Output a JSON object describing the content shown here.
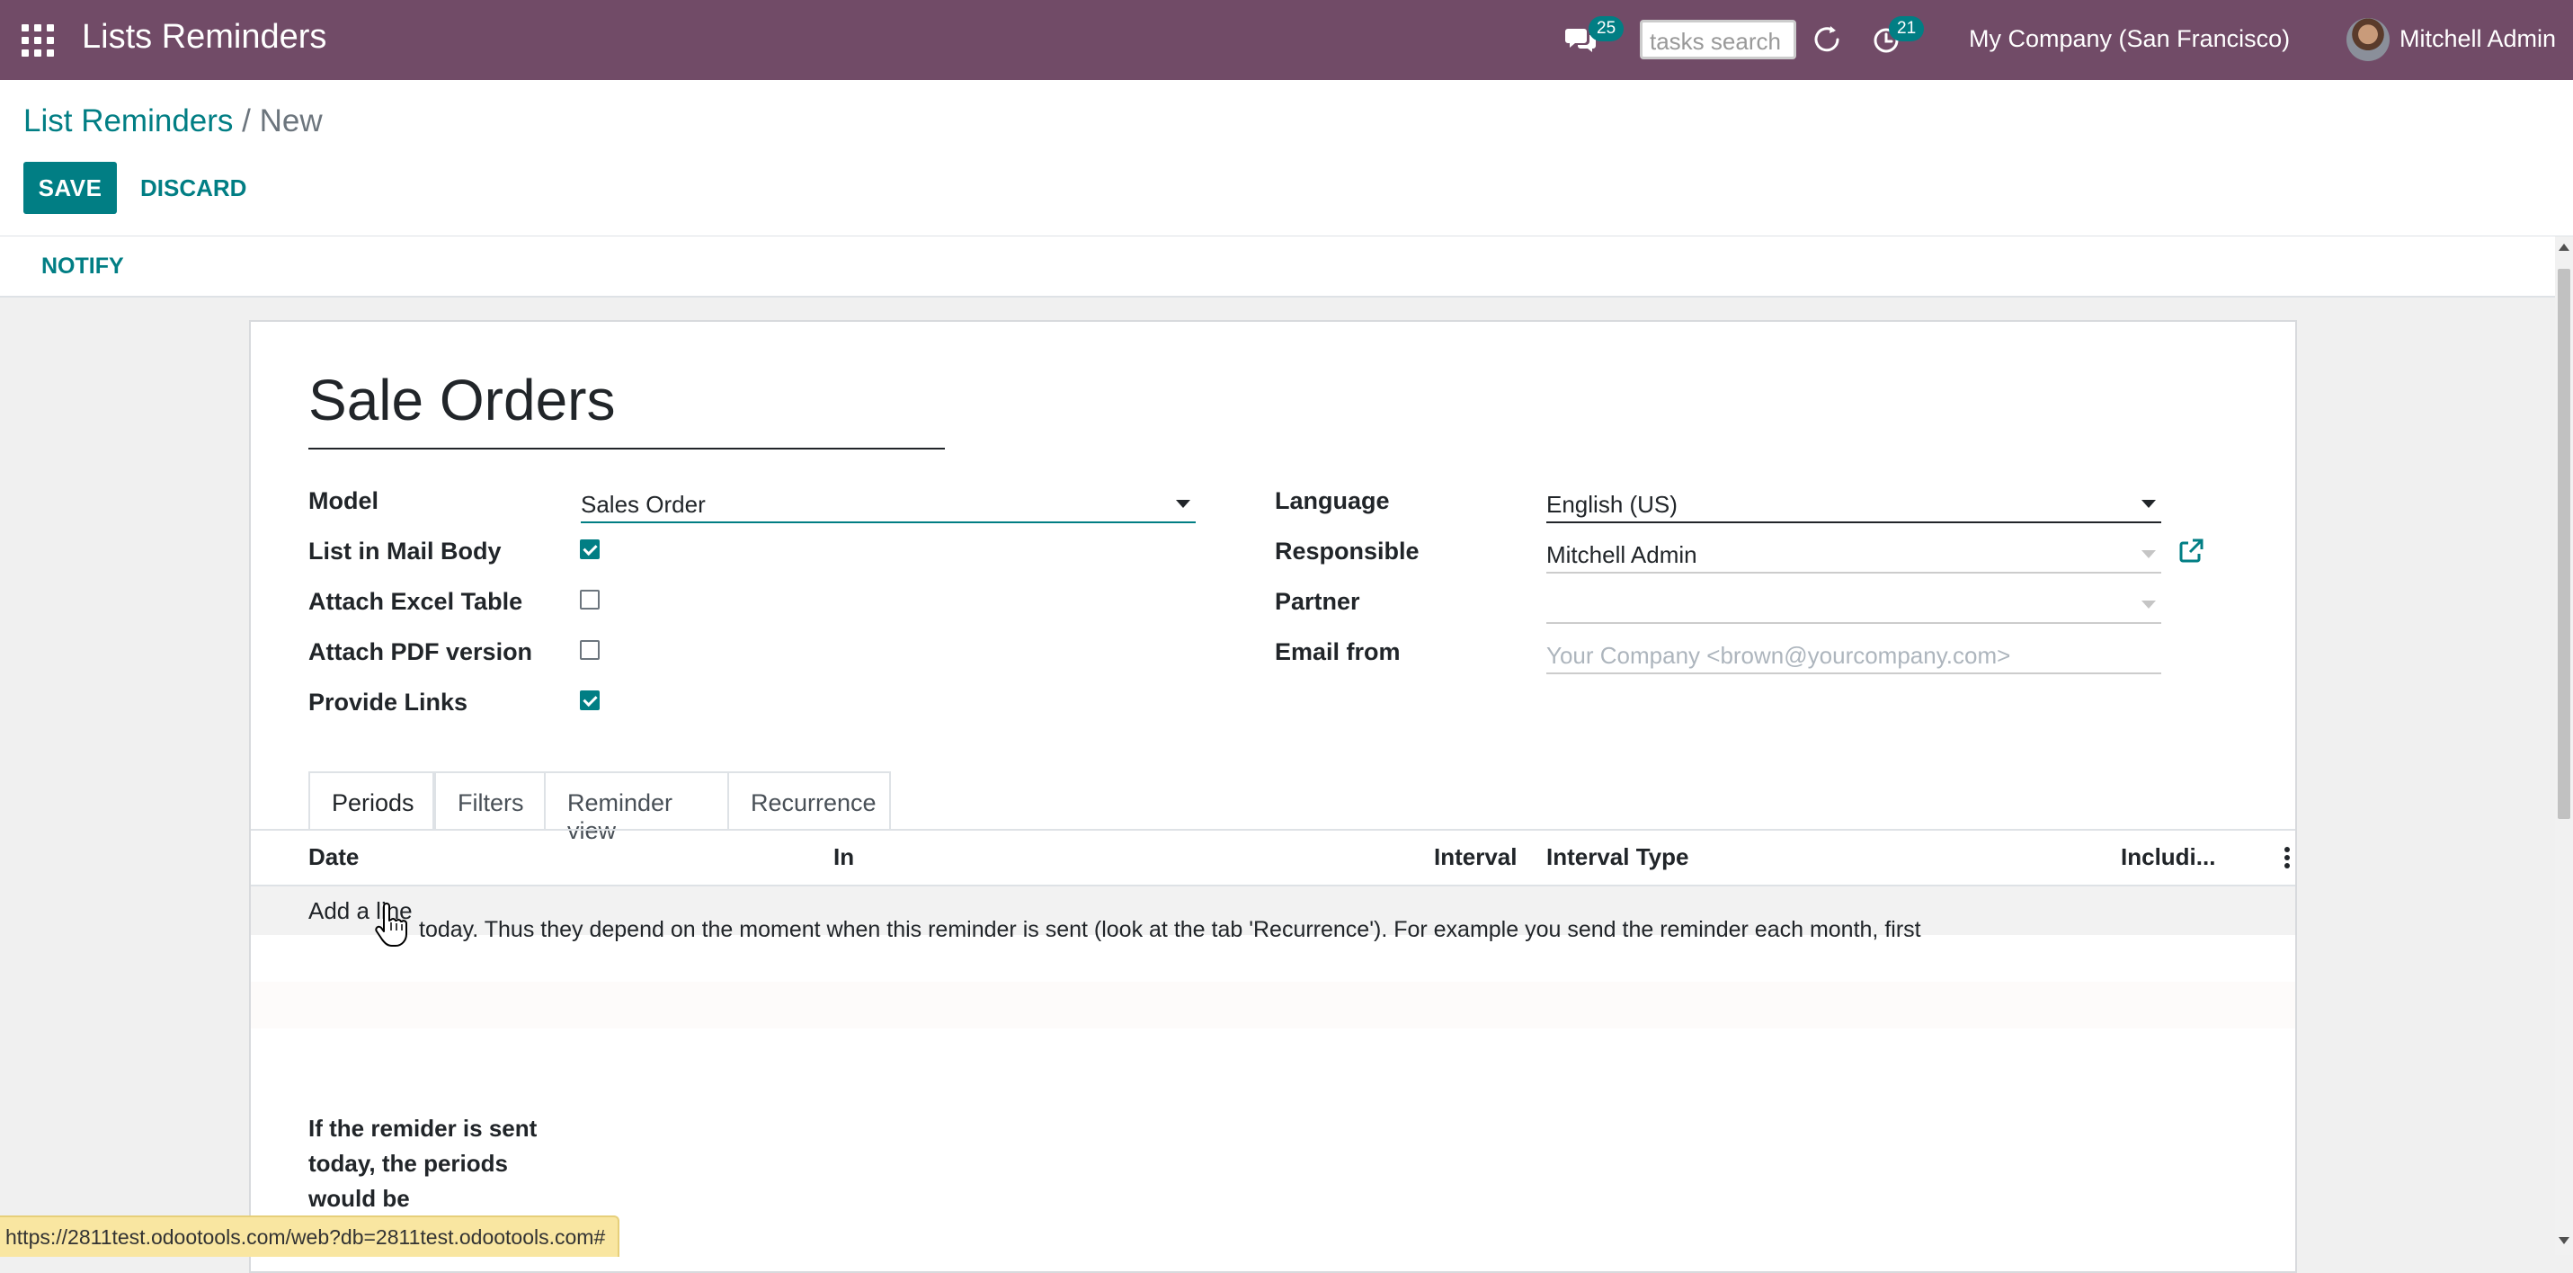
{
  "navbar": {
    "app_title": "Lists Reminders",
    "messages_count": "25",
    "search_placeholder": "tasks search",
    "activities_count": "21",
    "company": "My Company (San Francisco)",
    "user_name": "Mitchell Admin"
  },
  "breadcrumb": {
    "parent": "List Reminders",
    "separator": "/",
    "current": "New"
  },
  "actions": {
    "save": "SAVE",
    "discard": "DISCARD",
    "notify": "NOTIFY"
  },
  "form": {
    "name": "Sale Orders",
    "left_fields": {
      "model_label": "Model",
      "model_value": "Sales Order",
      "list_in_mail_label": "List in Mail Body",
      "list_in_mail_checked": true,
      "attach_excel_label": "Attach Excel Table",
      "attach_excel_checked": false,
      "attach_pdf_label": "Attach PDF version",
      "attach_pdf_checked": false,
      "provide_links_label": "Provide Links",
      "provide_links_checked": true
    },
    "right_fields": {
      "language_label": "Language",
      "language_value": "English (US)",
      "responsible_label": "Responsible",
      "responsible_value": "Mitchell Admin",
      "partner_label": "Partner",
      "partner_value": "",
      "email_from_label": "Email from",
      "email_from_placeholder": "Your Company <brown@yourcompany.com>"
    }
  },
  "tabs": [
    "Periods",
    "Filters",
    "Reminder view",
    "Recurrence"
  ],
  "active_tab": "Periods",
  "periods_table": {
    "columns": [
      "Date",
      "In",
      "Interval",
      "Interval Type",
      "Includi..."
    ],
    "add_line": "Add a line"
  },
  "info": {
    "title": "If the remider is sent today, the periods would be",
    "text": "today. Thus they depend on the moment when this reminder is sent (look at the tab 'Recurrence'). For example you send the reminder each month, first"
  },
  "status_url": "https://2811test.odootools.com/web?db=2811test.odootools.com#",
  "colors": {
    "navbar": "#714b67",
    "primary": "#017e84",
    "background": "#f0f0f0"
  }
}
